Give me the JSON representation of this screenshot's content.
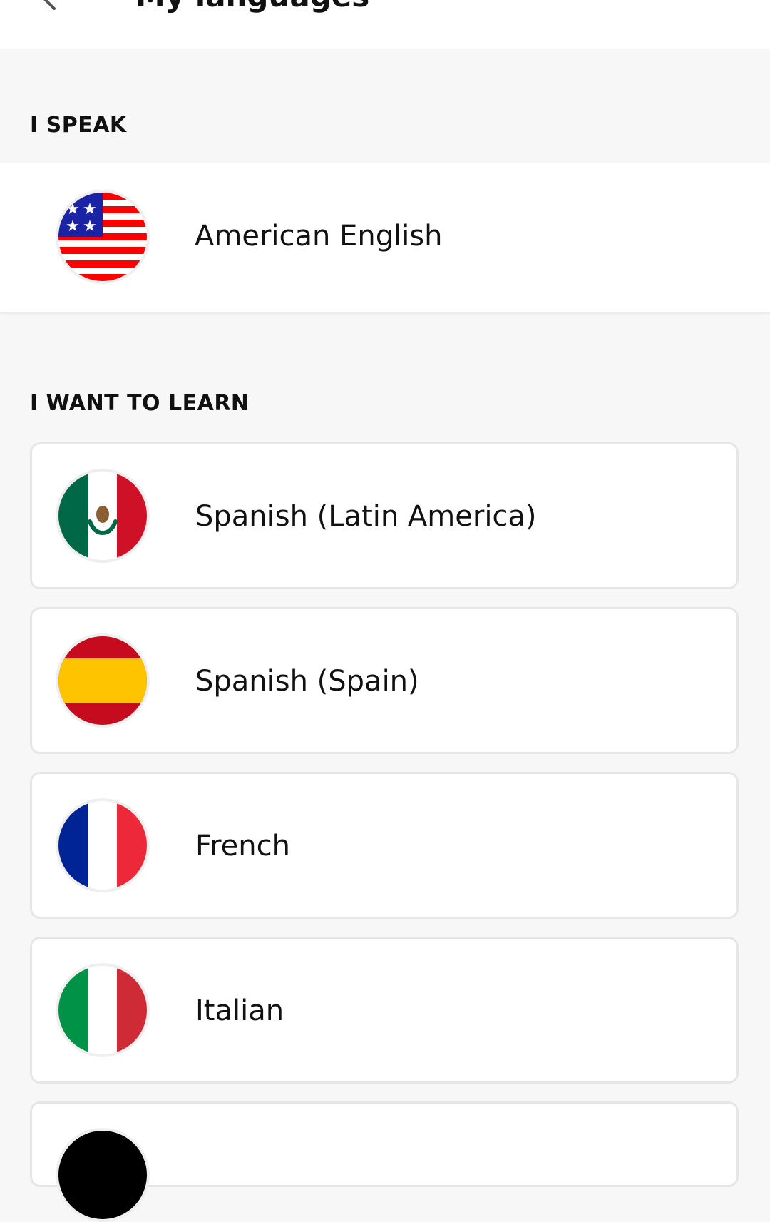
{
  "header": {
    "title": "My languages"
  },
  "speak_section": {
    "label": "I SPEAK",
    "language": {
      "name": "American English",
      "flag_icon": "us-flag-icon"
    }
  },
  "learn_section": {
    "label": "I WANT TO LEARN",
    "languages": [
      {
        "name": "Spanish (Latin America)",
        "flag_icon": "mexico-flag-icon"
      },
      {
        "name": "Spanish (Spain)",
        "flag_icon": "spain-flag-icon"
      },
      {
        "name": "French",
        "flag_icon": "france-flag-icon"
      },
      {
        "name": "Italian",
        "flag_icon": "italy-flag-icon"
      }
    ]
  },
  "colors": {
    "page_bg": "#f7f7f7",
    "card_border": "#e6e6e6",
    "us_red": "#ff0000",
    "us_blue": "#1a22a6",
    "mexico_green": "#006847",
    "mexico_red": "#ce1126",
    "spain_red": "#c60b1e",
    "spain_yellow": "#ffc400",
    "france_blue": "#002395",
    "france_red": "#ed2939",
    "italy_green": "#009246",
    "italy_red": "#ce2b37"
  }
}
